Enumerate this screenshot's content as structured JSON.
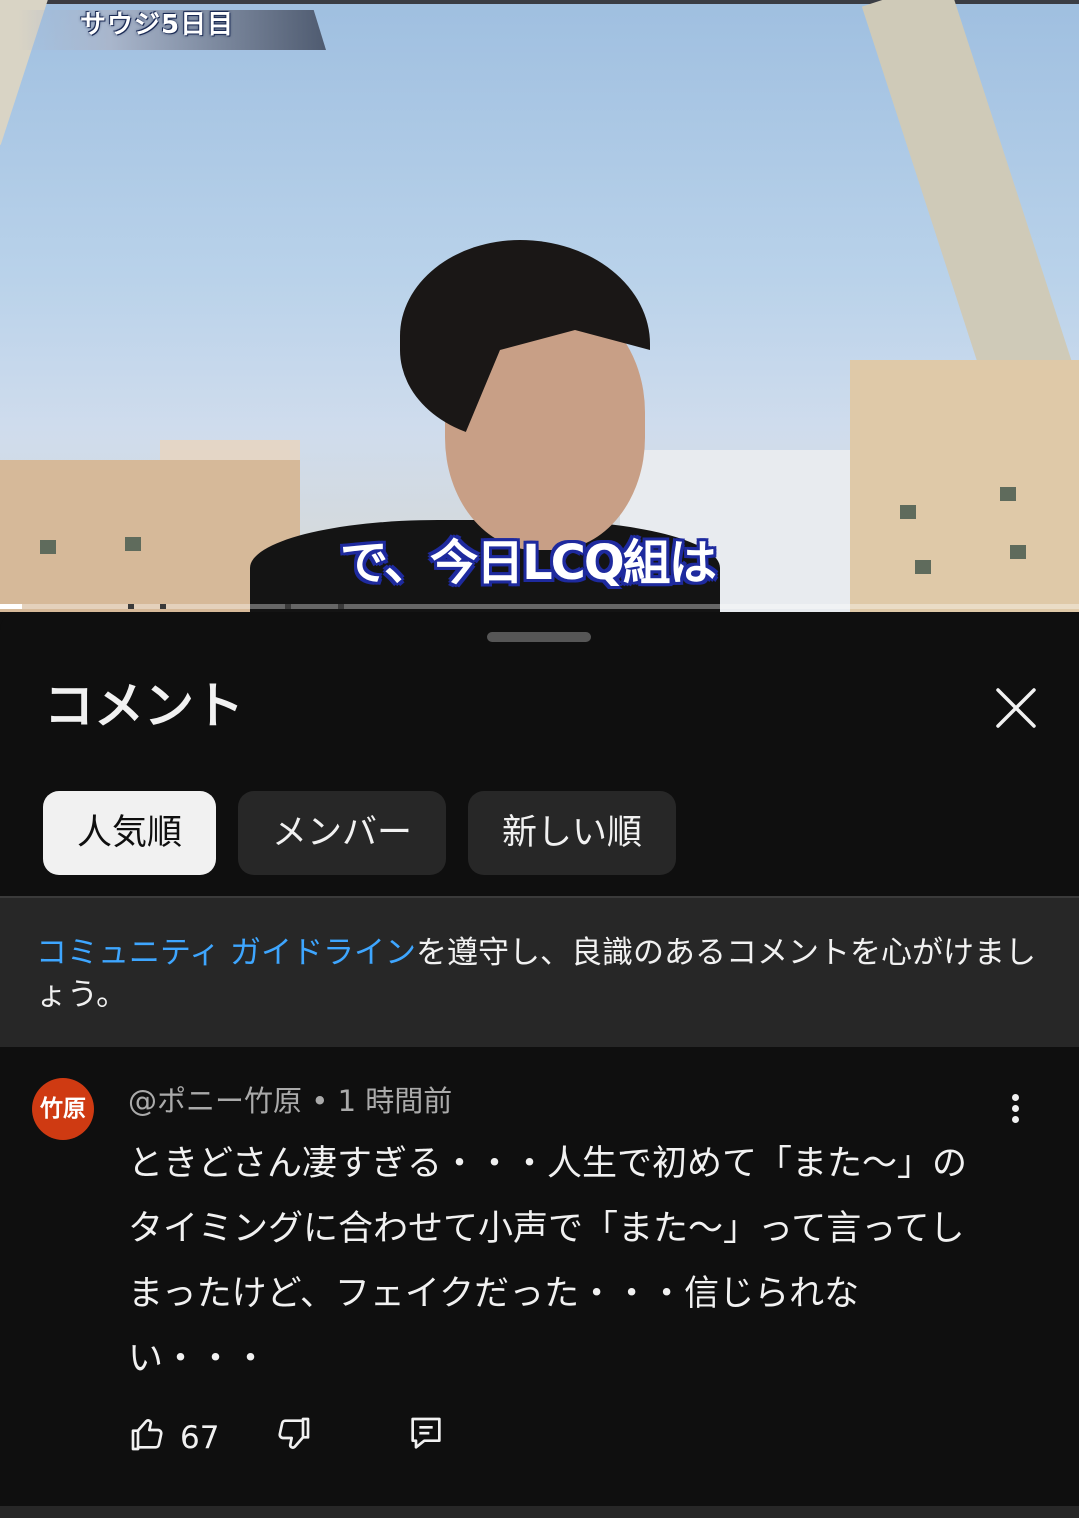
{
  "video": {
    "overlay_title": "サウジ5日目",
    "subtitle": "で、今日LCQ組は",
    "progress_fraction": 0.02
  },
  "panel": {
    "title": "コメント",
    "close_icon": "close-icon",
    "chips": [
      {
        "label": "人気順",
        "active": true
      },
      {
        "label": "メンバー",
        "active": false
      },
      {
        "label": "新しい順",
        "active": false
      }
    ],
    "notice": {
      "link_text": "コミュニティ ガイドライン",
      "text": "を遵守し、良識のあるコメントを心がけましょう。"
    }
  },
  "comment": {
    "avatar_text": "竹原",
    "author": "@ポニー竹原",
    "separator": " • ",
    "time": "1 時間前",
    "text": "ときどさん凄すぎる・・・人生で初めて「また〜」のタイミングに合わせて小声で「また〜」って言ってしまったけど、フェイクだった・・・信じられない・・・",
    "likes": "67",
    "icons": [
      "thumbs-up-icon",
      "thumbs-down-icon",
      "reply-icon",
      "more-vert-icon"
    ]
  },
  "colors": {
    "background": "#0f0f0f",
    "surface": "#272727",
    "link": "#3ea6ff",
    "avatar": "#cf3a12",
    "subtitle_outline": "#1e2a9e"
  }
}
